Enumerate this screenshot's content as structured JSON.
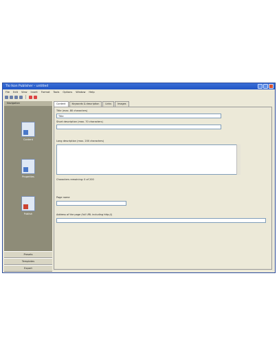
{
  "window": {
    "title": "Tlo Ikon Publisher – untitled"
  },
  "menu": [
    "File",
    "Edit",
    "View",
    "Insert",
    "Format",
    "Tools",
    "Options",
    "Window",
    "Help"
  ],
  "sidebar": {
    "header": "Navigation",
    "items": [
      {
        "label": "Content",
        "icon": "document-icon"
      },
      {
        "label": "Properties",
        "icon": "properties-document-icon"
      },
      {
        "label": "Publish",
        "icon": "publish-document-icon"
      }
    ],
    "buttons": [
      "Presets",
      "Templates",
      "Export"
    ]
  },
  "tabs": [
    "Content",
    "Keywords & description",
    "Links",
    "Images"
  ],
  "form": {
    "title_label": "Title (max. 80 characters)",
    "title_value": "Title",
    "short_desc_label": "Short description (max. 70 characters)",
    "short_desc_value": "",
    "long_desc_label": "Long description (max. 200 characters)",
    "long_desc_value": "",
    "hint": "Characters remaining: 0 of 200",
    "file_label": "Page name",
    "file_value": "",
    "url_label": "Address of the page (full URL including http://)",
    "url_value": ""
  }
}
